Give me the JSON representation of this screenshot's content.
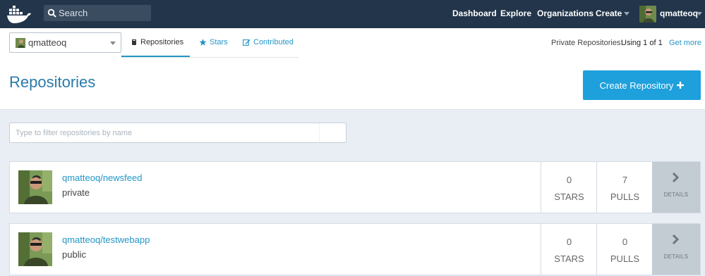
{
  "topnav": {
    "search_placeholder": "Search",
    "links": {
      "dashboard": "Dashboard",
      "explore": "Explore",
      "organizations": "Organizations",
      "create": "Create"
    },
    "username": "qmatteoq",
    "brand_color": "#22354a"
  },
  "header": {
    "selected_user": "qmatteoq",
    "tabs": {
      "repositories": "Repositories",
      "stars": "Stars",
      "contributed": "Contributed"
    },
    "private_label": "Private Repositories:",
    "private_using": "Using 1 of 1",
    "get_more": "Get more",
    "title": "Repositories",
    "create_button": "Create Repository"
  },
  "filter": {
    "placeholder": "Type to filter repositories by name"
  },
  "repos": [
    {
      "name": "qmatteoq/newsfeed",
      "visibility": "private",
      "stars": "0",
      "stars_label": "STARS",
      "pulls": "7",
      "pulls_label": "PULLS",
      "details": "DETAILS"
    },
    {
      "name": "qmatteoq/testwebapp",
      "visibility": "public",
      "stars": "0",
      "stars_label": "STARS",
      "pulls": "0",
      "pulls_label": "PULLS",
      "details": "DETAILS"
    }
  ],
  "colors": {
    "accent": "#1ea0dc",
    "link": "#2496c6",
    "title": "#2a7aa8"
  }
}
